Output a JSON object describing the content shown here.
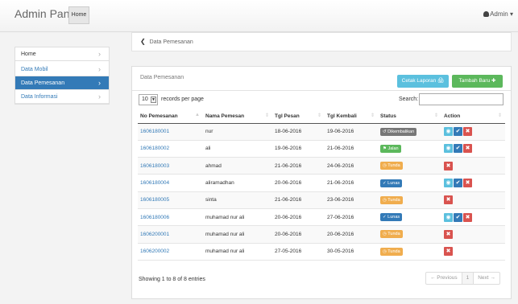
{
  "navbar": {
    "brand": "Admin Panel",
    "home": "Home",
    "user": "Admin ▾"
  },
  "sidebar": {
    "items": [
      {
        "label": "Home"
      },
      {
        "label": "Data Mobil"
      },
      {
        "label": "Data Pemesanan"
      },
      {
        "label": "Data Informasi"
      }
    ],
    "chevron": "›"
  },
  "breadcrumb": {
    "back": "❮",
    "label": "Data Pemesanan"
  },
  "panel": {
    "title": "Data Pemesanan",
    "print_button": "Cetak Laporan 🖨",
    "add_button": "Tambah Baru ✚"
  },
  "table_controls": {
    "length_value": "10",
    "length_label": "records per page",
    "search_label": "Search:",
    "search_value": ""
  },
  "table": {
    "headers": [
      "No Pemesanan",
      "Nama Pemesan",
      "Tgl Pesan",
      "Tgl Kembali",
      "Status",
      "Action"
    ],
    "rows": [
      {
        "no": "1606180001",
        "nama": "nur",
        "pesan": "18-06-2016",
        "kembali": "19-06-2016",
        "status": "Dikembalikan"
      },
      {
        "no": "1606180002",
        "nama": "ali",
        "pesan": "19-06-2016",
        "kembali": "21-06-2016",
        "status": "Jalan"
      },
      {
        "no": "1606180003",
        "nama": "ahmad",
        "pesan": "21-06-2016",
        "kembali": "24-06-2016",
        "status": "Tunda"
      },
      {
        "no": "1606180004",
        "nama": "aliramadhan",
        "pesan": "20-06-2016",
        "kembali": "21-06-2016",
        "status": "Lunas"
      },
      {
        "no": "1606180005",
        "nama": "sinta",
        "pesan": "21-06-2016",
        "kembali": "23-06-2016",
        "status": "Tunda"
      },
      {
        "no": "1606180006",
        "nama": "muhamad nur ali",
        "pesan": "20-06-2016",
        "kembali": "27-06-2016",
        "status": "Lunas"
      },
      {
        "no": "1606200001",
        "nama": "muhamad nur ali",
        "pesan": "20-06-2016",
        "kembali": "20-06-2016",
        "status": "Tunda"
      },
      {
        "no": "1606200002",
        "nama": "muhamad nur ali",
        "pesan": "27-05-2016",
        "kembali": "30-05-2016",
        "status": "Tunda"
      }
    ]
  },
  "footer": {
    "info": "Showing 1 to 8 of 8 entries",
    "prev": "← Previous",
    "page": "1",
    "next": "Next →"
  },
  "colors": {
    "primary": "#337ab7",
    "info": "#5bc0de",
    "success": "#5cb85c",
    "warning": "#f0ad4e",
    "danger": "#d9534f",
    "muted": "#777777"
  }
}
